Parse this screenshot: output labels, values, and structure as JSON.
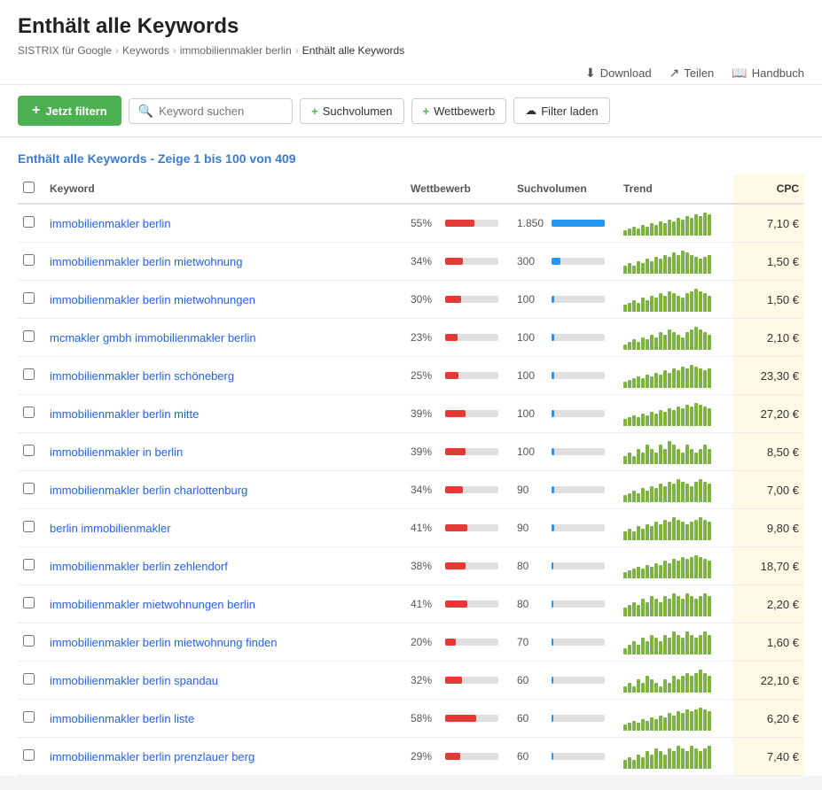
{
  "page": {
    "title": "Enthält alle Keywords",
    "breadcrumb": [
      {
        "label": "SISTRIX für Google",
        "href": "#"
      },
      {
        "label": "Keywords",
        "href": "#"
      },
      {
        "label": "immobilienmakler berlin",
        "href": "#"
      },
      {
        "label": "Enthält alle Keywords",
        "href": null
      }
    ],
    "topActions": [
      {
        "label": "Download",
        "icon": "download-icon"
      },
      {
        "label": "Teilen",
        "icon": "share-icon"
      },
      {
        "label": "Handbuch",
        "icon": "book-icon"
      }
    ],
    "toolbar": {
      "filterBtn": "Jetzt filtern",
      "searchPlaceholder": "Keyword suchen",
      "suchvolumenBtn": "Suchvolumen",
      "wettbewerbBtn": "Wettbewerb",
      "filterLadenBtn": "Filter laden"
    },
    "tableTitle": "Enthält alle Keywords - Zeige 1 bis 100 von 409",
    "columns": {
      "keyword": "Keyword",
      "wettbewerb": "Wettbewerb",
      "suchvolumen": "Suchvolumen",
      "trend": "Trend",
      "cpc": "CPC"
    },
    "rows": [
      {
        "keyword": "immobilienmakler berlin",
        "wettbewerb": 55,
        "suchvolumen": "1.850",
        "cpc": "7,10 €",
        "trend": [
          3,
          4,
          5,
          4,
          6,
          5,
          7,
          6,
          8,
          7,
          9,
          8,
          10,
          9,
          11,
          10,
          12,
          11,
          13,
          12
        ]
      },
      {
        "keyword": "immobilienmakler berlin mietwohnung",
        "wettbewerb": 34,
        "suchvolumen": "300",
        "cpc": "1,50 €",
        "trend": [
          4,
          5,
          4,
          6,
          5,
          7,
          6,
          8,
          7,
          9,
          8,
          10,
          9,
          11,
          10,
          9,
          8,
          7,
          8,
          9
        ]
      },
      {
        "keyword": "immobilienmakler berlin mietwohnungen",
        "wettbewerb": 30,
        "suchvolumen": "100",
        "cpc": "1,50 €",
        "trend": [
          3,
          4,
          5,
          4,
          6,
          5,
          7,
          6,
          8,
          7,
          9,
          8,
          7,
          6,
          8,
          9,
          10,
          9,
          8,
          7
        ]
      },
      {
        "keyword": "mcmakler gmbh immobilienmakler berlin",
        "wettbewerb": 23,
        "suchvolumen": "100",
        "cpc": "2,10 €",
        "trend": [
          2,
          3,
          4,
          3,
          5,
          4,
          6,
          5,
          7,
          6,
          8,
          7,
          6,
          5,
          7,
          8,
          9,
          8,
          7,
          6
        ]
      },
      {
        "keyword": "immobilienmakler berlin schöneberg",
        "wettbewerb": 25,
        "suchvolumen": "100",
        "cpc": "23,30 €",
        "trend": [
          3,
          4,
          5,
          6,
          5,
          7,
          6,
          8,
          7,
          9,
          8,
          10,
          9,
          11,
          10,
          12,
          11,
          10,
          9,
          10
        ]
      },
      {
        "keyword": "immobilienmakler berlin mitte",
        "wettbewerb": 39,
        "suchvolumen": "100",
        "cpc": "27,20 €",
        "trend": [
          4,
          5,
          6,
          5,
          7,
          6,
          8,
          7,
          9,
          8,
          10,
          9,
          11,
          10,
          12,
          11,
          13,
          12,
          11,
          10
        ]
      },
      {
        "keyword": "immobilienmakler in berlin",
        "wettbewerb": 39,
        "suchvolumen": "100",
        "cpc": "8,50 €",
        "trend": [
          2,
          3,
          2,
          4,
          3,
          5,
          4,
          3,
          5,
          4,
          6,
          5,
          4,
          3,
          5,
          4,
          3,
          4,
          5,
          4
        ]
      },
      {
        "keyword": "immobilienmakler berlin charlottenburg",
        "wettbewerb": 34,
        "suchvolumen": "90",
        "cpc": "7,00 €",
        "trend": [
          3,
          4,
          5,
          4,
          6,
          5,
          7,
          6,
          8,
          7,
          9,
          8,
          10,
          9,
          8,
          7,
          9,
          10,
          9,
          8
        ]
      },
      {
        "keyword": "berlin immobilienmakler",
        "wettbewerb": 41,
        "suchvolumen": "90",
        "cpc": "9,80 €",
        "trend": [
          4,
          5,
          4,
          6,
          5,
          7,
          6,
          8,
          7,
          9,
          8,
          10,
          9,
          8,
          7,
          8,
          9,
          10,
          9,
          8
        ]
      },
      {
        "keyword": "immobilienmakler berlin zehlendorf",
        "wettbewerb": 38,
        "suchvolumen": "80",
        "cpc": "18,70 €",
        "trend": [
          3,
          4,
          5,
          6,
          5,
          7,
          6,
          8,
          7,
          9,
          8,
          10,
          9,
          11,
          10,
          11,
          12,
          11,
          10,
          9
        ]
      },
      {
        "keyword": "immobilienmakler mietwohnungen berlin",
        "wettbewerb": 41,
        "suchvolumen": "80",
        "cpc": "2,20 €",
        "trend": [
          3,
          4,
          5,
          4,
          6,
          5,
          7,
          6,
          5,
          7,
          6,
          8,
          7,
          6,
          8,
          7,
          6,
          7,
          8,
          7
        ]
      },
      {
        "keyword": "immobilienmakler berlin mietwohnung finden",
        "wettbewerb": 20,
        "suchvolumen": "70",
        "cpc": "1,60 €",
        "trend": [
          2,
          3,
          4,
          3,
          5,
          4,
          6,
          5,
          4,
          6,
          5,
          7,
          6,
          5,
          7,
          6,
          5,
          6,
          7,
          6
        ]
      },
      {
        "keyword": "immobilienmakler berlin spandau",
        "wettbewerb": 32,
        "suchvolumen": "60",
        "cpc": "22,10 €",
        "trend": [
          2,
          3,
          2,
          4,
          3,
          5,
          4,
          3,
          2,
          4,
          3,
          5,
          4,
          5,
          6,
          5,
          6,
          7,
          6,
          5
        ]
      },
      {
        "keyword": "immobilienmakler berlin liste",
        "wettbewerb": 58,
        "suchvolumen": "60",
        "cpc": "6,20 €",
        "trend": [
          3,
          4,
          5,
          4,
          6,
          5,
          7,
          6,
          8,
          7,
          9,
          8,
          10,
          9,
          11,
          10,
          11,
          12,
          11,
          10
        ]
      },
      {
        "keyword": "immobilienmakler berlin prenzlauer berg",
        "wettbewerb": 29,
        "suchvolumen": "60",
        "cpc": "7,40 €",
        "trend": [
          3,
          4,
          3,
          5,
          4,
          6,
          5,
          7,
          6,
          5,
          7,
          6,
          8,
          7,
          6,
          8,
          7,
          6,
          7,
          8
        ]
      }
    ]
  }
}
